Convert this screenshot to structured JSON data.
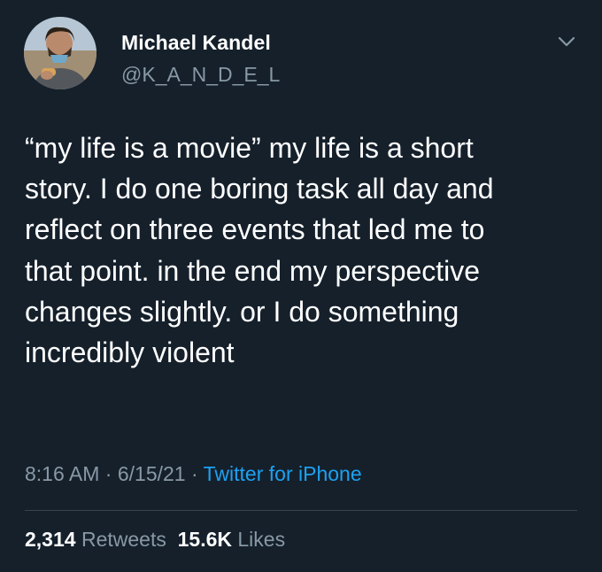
{
  "user": {
    "name": "Michael Kandel",
    "handle": "@K_A_N_D_E_L"
  },
  "tweet": {
    "lines": [
      "“my life is a movie” my life is a short",
      "story. I do one boring task all day and",
      "reflect on three events that led me to",
      "that point. in the end my perspective",
      "changes slightly. or I do something",
      "incredibly violent"
    ]
  },
  "meta": {
    "time": "8:16 AM",
    "separator": "·",
    "date": "6/15/21",
    "source": "Twitter for iPhone"
  },
  "stats": {
    "retweets_count": "2,314",
    "retweets_label": "Retweets",
    "likes_count": "15.6K",
    "likes_label": "Likes"
  },
  "icons": {
    "menu": "chevron-down-icon"
  },
  "colors": {
    "background": "#15202b",
    "text": "#ffffff",
    "secondary": "#8899a6",
    "link": "#1da1f2",
    "divider": "#38444d"
  }
}
